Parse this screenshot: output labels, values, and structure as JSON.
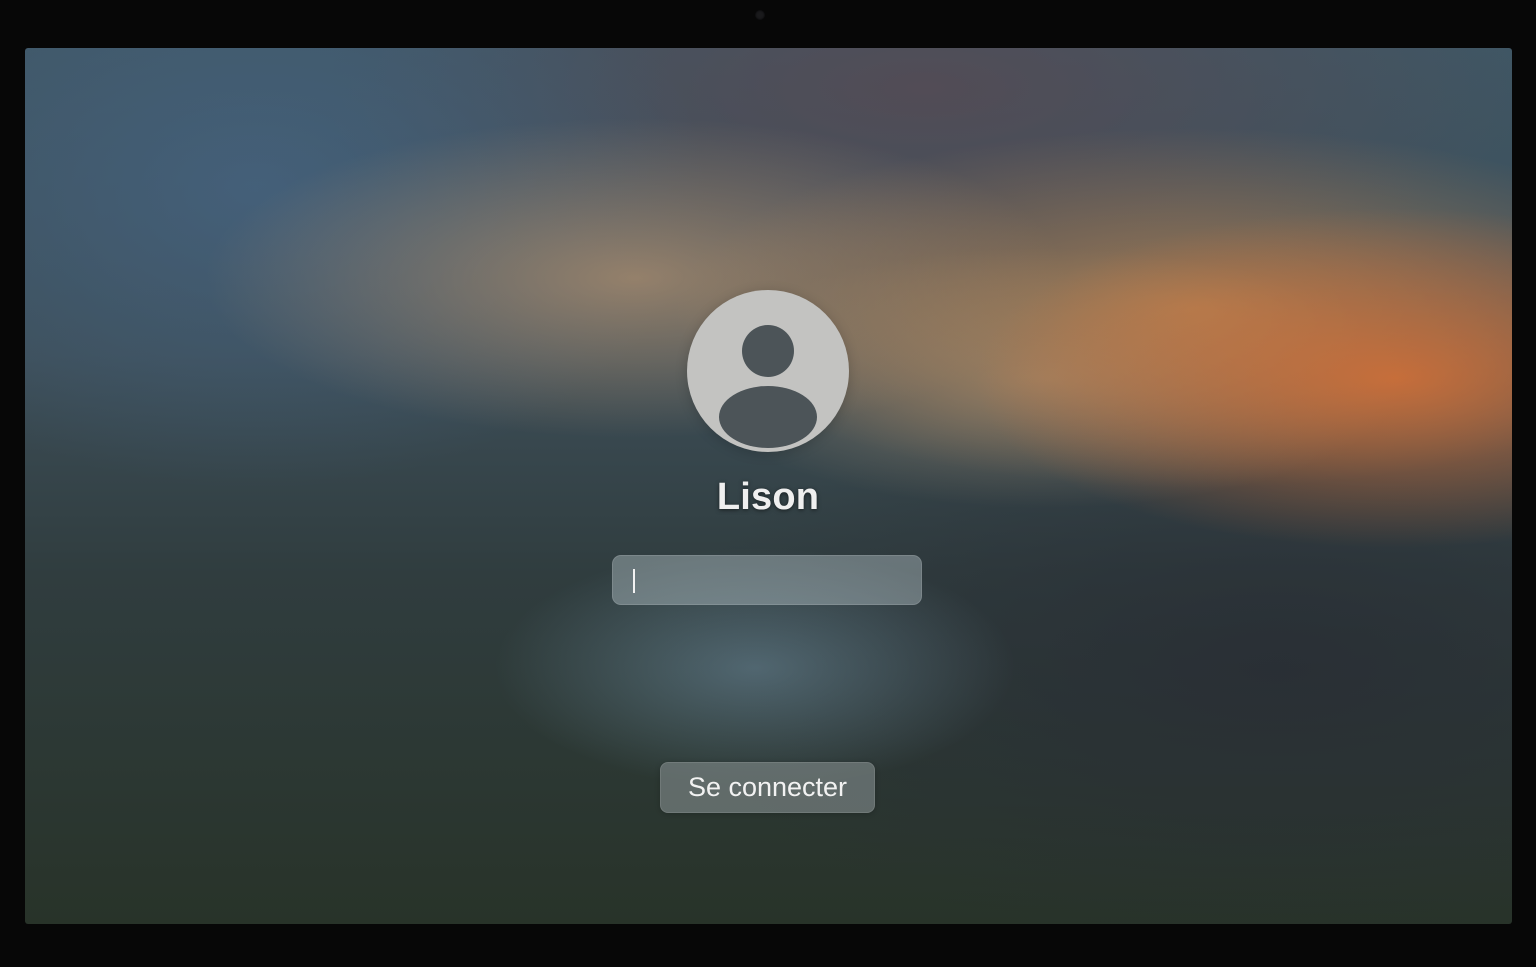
{
  "login": {
    "username": "Lison",
    "password_value": "",
    "signin_label": "Se connecter"
  },
  "icons": {
    "avatar": "user-silhouette-icon"
  },
  "colors": {
    "avatar_background": "#c3c3c1",
    "avatar_figure": "#4c5458",
    "text": "#efefef"
  }
}
